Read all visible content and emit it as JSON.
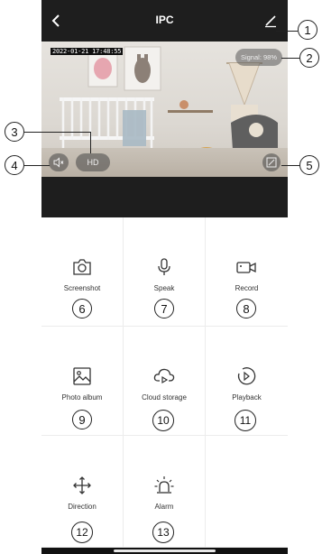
{
  "header": {
    "title": "IPC"
  },
  "video": {
    "timestamp": "2022-01-21 17:48:55",
    "signal": "Signal: 98%",
    "quality": "HD"
  },
  "functions": [
    {
      "label": "Screenshot",
      "icon": "camera-icon",
      "callout": "6"
    },
    {
      "label": "Speak",
      "icon": "microphone-icon",
      "callout": "7"
    },
    {
      "label": "Record",
      "icon": "video-record-icon",
      "callout": "8"
    },
    {
      "label": "Photo album",
      "icon": "photo-album-icon",
      "callout": "9"
    },
    {
      "label": "Cloud storage",
      "icon": "cloud-storage-icon",
      "callout": "10"
    },
    {
      "label": "Playback",
      "icon": "playback-icon",
      "callout": "11"
    },
    {
      "label": "Direction",
      "icon": "direction-icon",
      "callout": "12"
    },
    {
      "label": "Alarm",
      "icon": "alarm-icon",
      "callout": "13"
    }
  ],
  "callouts": {
    "edit": "1",
    "signal": "2",
    "hd": "3",
    "mute": "4",
    "fullscreen": "5"
  }
}
